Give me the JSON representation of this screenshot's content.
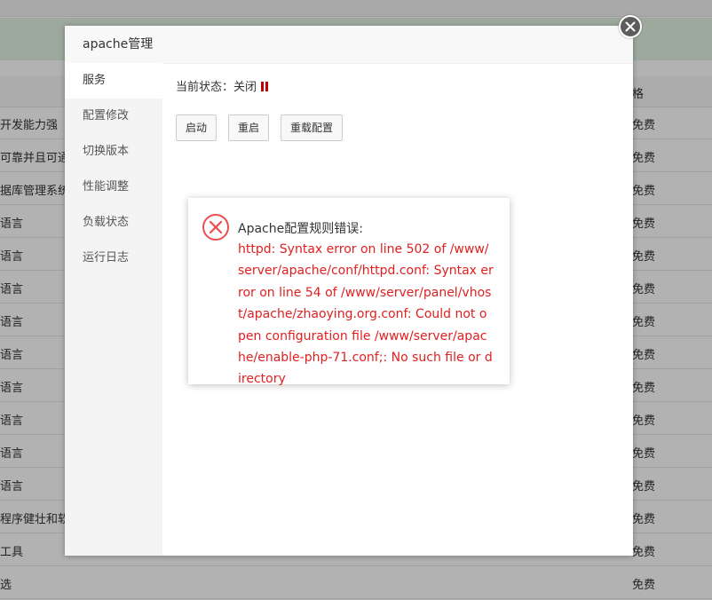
{
  "background": {
    "price_header": "格",
    "rows": [
      {
        "name": "开发能力强",
        "price": "免费"
      },
      {
        "name": "可靠并且可通过",
        "price": "免费"
      },
      {
        "name": "据库管理系统!",
        "price": "免费"
      },
      {
        "name": "语言",
        "price": "免费"
      },
      {
        "name": "语言",
        "price": "免费"
      },
      {
        "name": "语言",
        "price": "免费"
      },
      {
        "name": "语言",
        "price": "免费"
      },
      {
        "name": "语言",
        "price": "免费"
      },
      {
        "name": "语言",
        "price": "免费"
      },
      {
        "name": "语言",
        "price": "免费"
      },
      {
        "name": "语言",
        "price": "免费"
      },
      {
        "name": "语言",
        "price": "免费"
      },
      {
        "name": "程序健壮和软件",
        "price": "免费"
      },
      {
        "name": "工具",
        "price": "免费"
      },
      {
        "name": "选",
        "price": "免费"
      }
    ]
  },
  "window": {
    "title": "apache管理",
    "sidebar": [
      "服务",
      "配置修改",
      "切换版本",
      "性能调整",
      "负载状态",
      "运行日志"
    ],
    "status_label": "当前状态：关闭",
    "status_icon": "pause-icon",
    "status_color": "#c00000",
    "buttons": {
      "start": "启动",
      "restart": "重启",
      "reload": "重载配置"
    }
  },
  "error_dialog": {
    "icon": "error-circle-icon",
    "title": "Apache配置规则错误:",
    "message": "httpd: Syntax error on line 502 of /www/server/apache/conf/httpd.conf: Syntax error on line 54 of /www/server/panel/vhost/apache/zhaoying.org.conf: Could not open configuration file /www/server/apache/enable-php-71.conf;: No such file or directory",
    "color": "#e02020"
  }
}
